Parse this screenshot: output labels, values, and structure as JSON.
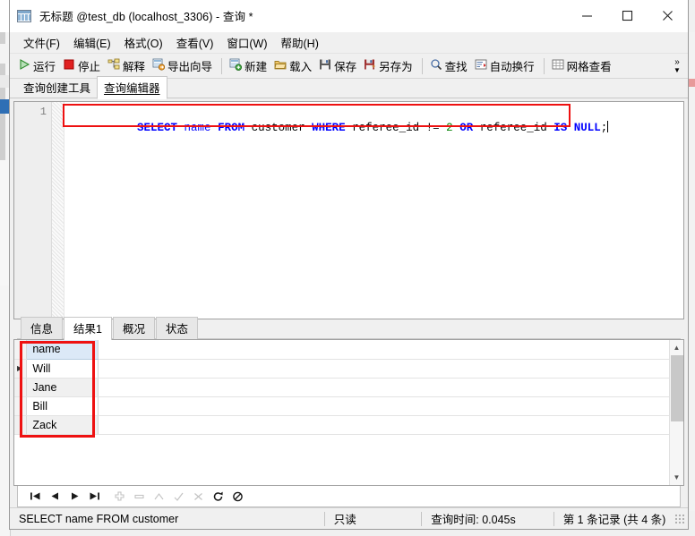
{
  "window": {
    "title": "无标题 @test_db (localhost_3306) - 查询 *",
    "icon": "query-window-icon",
    "controls": {
      "minimize": "—",
      "maximize": "□",
      "close": "✕"
    }
  },
  "menu": {
    "items": [
      {
        "label": "文件(F)",
        "name": "menu-file"
      },
      {
        "label": "编辑(E)",
        "name": "menu-edit"
      },
      {
        "label": "格式(O)",
        "name": "menu-format"
      },
      {
        "label": "查看(V)",
        "name": "menu-view"
      },
      {
        "label": "窗口(W)",
        "name": "menu-window"
      },
      {
        "label": "帮助(H)",
        "name": "menu-help"
      }
    ]
  },
  "toolbar": {
    "run": "运行",
    "stop": "停止",
    "explain": "解释",
    "export_wizard": "导出向导",
    "new": "新建",
    "load": "载入",
    "save": "保存",
    "save_as": "另存为",
    "find": "查找",
    "word_wrap": "自动换行",
    "grid_view": "网格查看",
    "overflow": "»"
  },
  "mode_tabs": [
    {
      "label": "查询创建工具",
      "active": false
    },
    {
      "label": "查询编辑器",
      "active": true
    }
  ],
  "editor": {
    "line_number": "1",
    "sql_tokens": [
      {
        "text": "SELECT",
        "type": "kw"
      },
      {
        "text": " ",
        "type": "pln"
      },
      {
        "text": "name",
        "type": "idn"
      },
      {
        "text": " ",
        "type": "pln"
      },
      {
        "text": "FROM",
        "type": "kw"
      },
      {
        "text": " customer ",
        "type": "pln"
      },
      {
        "text": "WHERE",
        "type": "kw"
      },
      {
        "text": " referee_id != ",
        "type": "pln"
      },
      {
        "text": "2",
        "type": "num"
      },
      {
        "text": " ",
        "type": "pln"
      },
      {
        "text": "OR",
        "type": "kw"
      },
      {
        "text": " referee_id ",
        "type": "pln"
      },
      {
        "text": "IS",
        "type": "kw"
      },
      {
        "text": " ",
        "type": "pln"
      },
      {
        "text": "NULL",
        "type": "kw"
      },
      {
        "text": ";",
        "type": "pln"
      }
    ],
    "sql_plain": "SELECT name FROM customer WHERE referee_id != 2 OR referee_id IS NULL;"
  },
  "result_tabs": [
    {
      "label": "信息",
      "active": false
    },
    {
      "label": "结果1",
      "active": true
    },
    {
      "label": "概况",
      "active": false
    },
    {
      "label": "状态",
      "active": false
    }
  ],
  "grid": {
    "columns": [
      "name"
    ],
    "rows": [
      {
        "name": "Will",
        "current": true
      },
      {
        "name": "Jane",
        "current": false
      },
      {
        "name": "Bill",
        "current": false
      },
      {
        "name": "Zack",
        "current": false
      }
    ],
    "current_row_marker": "▶"
  },
  "nav": {
    "first": "first-record",
    "prev": "previous-record",
    "next": "next-record",
    "last": "last-record",
    "insert": "insert-record",
    "delete": "delete-record",
    "apply": "apply-change",
    "confirm": "confirm-change",
    "cancel": "cancel-change",
    "refresh": "refresh",
    "stop": "stop"
  },
  "status": {
    "query": "SELECT name FROM customer",
    "readonly": "只读",
    "time": "查询时间: 0.045s",
    "record": "第 1 条记录 (共 4 条)"
  },
  "colors": {
    "keyword": "#0000ff",
    "number": "#008000",
    "plain": "#000000",
    "annotation": "#ee1111",
    "header_bg": "#dce9f7",
    "alt_row": "#f0f0f0"
  }
}
